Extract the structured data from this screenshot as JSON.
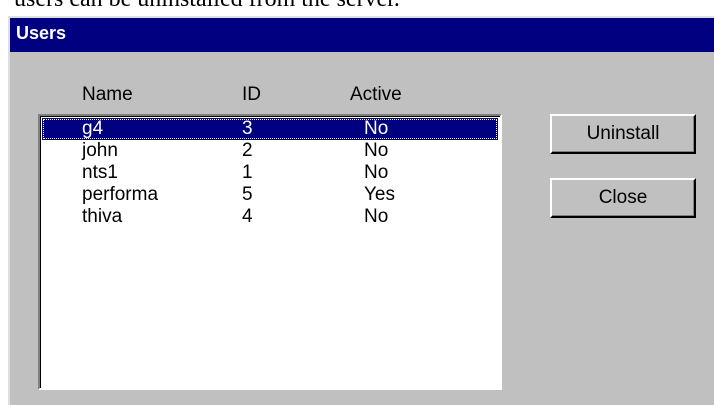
{
  "document": {
    "text_fragment": "users can be uninstalled from the server."
  },
  "window": {
    "title": "Users"
  },
  "list": {
    "columns": [
      "Name",
      "ID",
      "Active"
    ],
    "rows": [
      {
        "name": "g4",
        "id": "3",
        "active": "No",
        "selected": true
      },
      {
        "name": "john",
        "id": "2",
        "active": "No",
        "selected": false
      },
      {
        "name": "nts1",
        "id": "1",
        "active": "No",
        "selected": false
      },
      {
        "name": "performa",
        "id": "5",
        "active": "Yes",
        "selected": false
      },
      {
        "name": "thiva",
        "id": "4",
        "active": "No",
        "selected": false
      }
    ]
  },
  "buttons": {
    "uninstall": "Uninstall",
    "close": "Close"
  },
  "colors": {
    "title_bar": "#000080",
    "dialog_bg": "#c0c0c0",
    "selection": "#000080"
  }
}
